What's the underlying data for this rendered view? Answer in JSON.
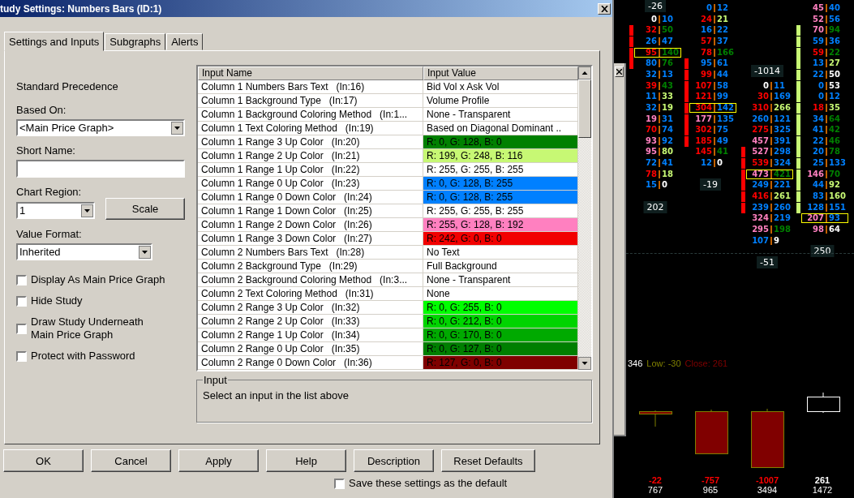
{
  "dialog": {
    "title": "tudy Settings: Numbers Bars (ID:1)",
    "tabs": [
      {
        "label": "Settings and Inputs",
        "selected": true
      },
      {
        "label": "Subgraphs",
        "selected": false
      },
      {
        "label": "Alerts",
        "selected": false
      }
    ],
    "precedence": "Standard Precedence",
    "based_on": {
      "label": "Based On:",
      "value": "<Main Price Graph>"
    },
    "short_name": {
      "label": "Short Name:"
    },
    "chart_region": {
      "label": "Chart Region:",
      "value": "1"
    },
    "scale_button": "Scale",
    "value_format": {
      "label": "Value Format:",
      "value": "Inherited"
    },
    "options": [
      {
        "label": "Display As Main Price Graph",
        "checked": false
      },
      {
        "label": "Hide Study",
        "checked": false
      },
      {
        "label": "Draw Study Underneath Main Price Graph",
        "checked": false
      },
      {
        "label": "Protect with Password",
        "checked": false
      }
    ],
    "table": {
      "columns": [
        "Input Name",
        "Input Value"
      ],
      "rows": [
        {
          "name": "Column 1 Numbers Bars Text   (In:16)",
          "value": "Bid Vol x Ask Vol"
        },
        {
          "name": "Column 1 Background Type   (In:17)",
          "value": "Volume Profile"
        },
        {
          "name": "Column 1 Background Coloring Method   (In:1...",
          "value": "None - Transparent"
        },
        {
          "name": "Column 1 Text Coloring Method   (In:19)",
          "value": "Based on Diagonal Dominant .."
        },
        {
          "name": "Column 1 Range 3 Up Color   (In:20)",
          "value": "R: 0, G: 128, B: 0",
          "color": "#008000"
        },
        {
          "name": "Column 1 Range 2 Up Color   (In:21)",
          "value": "R: 199, G: 248, B: 116",
          "color": "#c7f874"
        },
        {
          "name": "Column 1 Range 1 Up Color   (In:22)",
          "value": "R: 255, G: 255, B: 255",
          "color": "#ffffff"
        },
        {
          "name": "Column 1 Range 0 Up Color   (In:23)",
          "value": "R: 0, G: 128, B: 255",
          "color": "#0080ff"
        },
        {
          "name": "Column 1 Range 0 Down Color   (In:24)",
          "value": "R: 0, G: 128, B: 255",
          "color": "#0080ff"
        },
        {
          "name": "Column 1 Range 1 Down Color   (In:25)",
          "value": "R: 255, G: 255, B: 255",
          "color": "#ffffff"
        },
        {
          "name": "Column 1 Range 2 Down Color   (In:26)",
          "value": "R: 255, G: 128, B: 192",
          "color": "#ff80c0"
        },
        {
          "name": "Column 1 Range 3 Down Color   (In:27)",
          "value": "R: 242, G: 0, B: 0",
          "color": "#f20000"
        },
        {
          "name": "Column 2 Numbers Bars Text   (In:28)",
          "value": "No Text"
        },
        {
          "name": "Column 2 Background Type   (In:29)",
          "value": "Full Background"
        },
        {
          "name": "Column 2 Background Coloring Method   (In:3...",
          "value": "None - Transparent"
        },
        {
          "name": "Column 2 Text Coloring Method   (In:31)",
          "value": "None"
        },
        {
          "name": "Column 2 Range 3 Up Color   (In:32)",
          "value": "R: 0, G: 255, B: 0",
          "color": "#00ff00"
        },
        {
          "name": "Column 2 Range 2 Up Color   (In:33)",
          "value": "R: 0, G: 212, B: 0",
          "color": "#00d400"
        },
        {
          "name": "Column 2 Range 1 Up Color   (In:34)",
          "value": "R: 0, G: 170, B: 0",
          "color": "#00aa00"
        },
        {
          "name": "Column 2 Range 0 Up Color   (In:35)",
          "value": "R: 0, G: 127, B: 0",
          "color": "#007f00"
        },
        {
          "name": "Column 2 Range 0 Down Color   (In:36)",
          "value": "R: 127, G: 0, B: 0",
          "color": "#7f0000"
        }
      ]
    },
    "input_group": {
      "title": "Input",
      "text": "Select an input in the list above"
    },
    "buttons": [
      "OK",
      "Cancel",
      "Apply",
      "Help",
      "Description",
      "Reset Defaults"
    ],
    "save_default": {
      "label": "Save these settings as the default",
      "checked": false
    }
  },
  "chart": {
    "columns": [
      {
        "top_label": "-26",
        "color": "#ff0000",
        "bottom_label": "202",
        "rows": [
          {
            "bid": {
              "text": "0",
              "color": "#ffffff"
            },
            "ask": {
              "text": "10",
              "color": "#0080ff"
            },
            "bar": false,
            "boxed": false
          },
          {
            "bid": {
              "text": "32",
              "color": "#ff0000"
            },
            "ask": {
              "text": "50",
              "color": "#008000"
            },
            "bar": true,
            "boxed": false
          },
          {
            "bid": {
              "text": "26",
              "color": "#0080ff"
            },
            "ask": {
              "text": "47",
              "color": "#0080ff"
            },
            "bar": true,
            "boxed": false
          },
          {
            "bid": {
              "text": "95",
              "color": "#ff0000"
            },
            "ask": {
              "text": "140",
              "color": "#008000"
            },
            "bar": true,
            "boxed": true
          },
          {
            "bid": {
              "text": "80",
              "color": "#0080ff"
            },
            "ask": {
              "text": "76",
              "color": "#008000"
            },
            "bar": true,
            "boxed": false
          },
          {
            "bid": {
              "text": "32",
              "color": "#0080ff"
            },
            "ask": {
              "text": "13",
              "color": "#0080ff"
            },
            "bar": false,
            "boxed": false
          },
          {
            "bid": {
              "text": "39",
              "color": "#ff0000"
            },
            "ask": {
              "text": "43",
              "color": "#008000"
            },
            "bar": false,
            "boxed": false
          },
          {
            "bid": {
              "text": "11",
              "color": "#0080ff"
            },
            "ask": {
              "text": "33",
              "color": "#c7f874"
            },
            "bar": false,
            "boxed": false
          },
          {
            "bid": {
              "text": "32",
              "color": "#0080ff"
            },
            "ask": {
              "text": "19",
              "color": "#c7f874"
            },
            "bar": false,
            "boxed": false
          },
          {
            "bid": {
              "text": "19",
              "color": "#ff80c0"
            },
            "ask": {
              "text": "31",
              "color": "#0080ff"
            },
            "bar": false,
            "boxed": false
          },
          {
            "bid": {
              "text": "70",
              "color": "#ff0000"
            },
            "ask": {
              "text": "74",
              "color": "#0080ff"
            },
            "bar": false,
            "boxed": false
          },
          {
            "bid": {
              "text": "93",
              "color": "#ff80c0"
            },
            "ask": {
              "text": "92",
              "color": "#0080ff"
            },
            "bar": false,
            "boxed": false
          },
          {
            "bid": {
              "text": "95",
              "color": "#ff80c0"
            },
            "ask": {
              "text": "80",
              "color": "#c7f874"
            },
            "bar": false,
            "boxed": false
          },
          {
            "bid": {
              "text": "72",
              "color": "#0080ff"
            },
            "ask": {
              "text": "41",
              "color": "#0080ff"
            },
            "bar": false,
            "boxed": false
          },
          {
            "bid": {
              "text": "78",
              "color": "#ff0000"
            },
            "ask": {
              "text": "18",
              "color": "#c7f874"
            },
            "bar": false,
            "boxed": false
          },
          {
            "bid": {
              "text": "15",
              "color": "#0080ff"
            },
            "ask": {
              "text": "0",
              "color": "#ffffff"
            },
            "bar": false,
            "boxed": false
          }
        ]
      },
      {
        "color": "#ff0000",
        "bottom_label": "-19",
        "rows": [
          {
            "bid": {
              "text": "0",
              "color": "#0080ff"
            },
            "ask": {
              "text": "12",
              "color": "#0080ff"
            },
            "bar": false,
            "boxed": false
          },
          {
            "bid": {
              "text": "24",
              "color": "#ff0000"
            },
            "ask": {
              "text": "21",
              "color": "#c7f874"
            },
            "bar": false,
            "boxed": false
          },
          {
            "bid": {
              "text": "16",
              "color": "#0080ff"
            },
            "ask": {
              "text": "22",
              "color": "#0080ff"
            },
            "bar": false,
            "boxed": false
          },
          {
            "bid": {
              "text": "57",
              "color": "#ff0000"
            },
            "ask": {
              "text": "37",
              "color": "#0080ff"
            },
            "bar": false,
            "boxed": false
          },
          {
            "bid": {
              "text": "78",
              "color": "#ff0000"
            },
            "ask": {
              "text": "166",
              "color": "#008000"
            },
            "bar": false,
            "boxed": false
          },
          {
            "bid": {
              "text": "95",
              "color": "#0080ff"
            },
            "ask": {
              "text": "61",
              "color": "#0080ff"
            },
            "bar": true,
            "boxed": false
          },
          {
            "bid": {
              "text": "99",
              "color": "#ff0000"
            },
            "ask": {
              "text": "44",
              "color": "#0080ff"
            },
            "bar": true,
            "boxed": false
          },
          {
            "bid": {
              "text": "107",
              "color": "#ff0000"
            },
            "ask": {
              "text": "58",
              "color": "#0080ff"
            },
            "bar": true,
            "boxed": false
          },
          {
            "bid": {
              "text": "121",
              "color": "#ff0000"
            },
            "ask": {
              "text": "99",
              "color": "#0080ff"
            },
            "bar": true,
            "boxed": false
          },
          {
            "bid": {
              "text": "304",
              "color": "#ff0000"
            },
            "ask": {
              "text": "142",
              "color": "#0080ff"
            },
            "bar": true,
            "boxed": true
          },
          {
            "bid": {
              "text": "177",
              "color": "#ff80c0"
            },
            "ask": {
              "text": "135",
              "color": "#0080ff"
            },
            "bar": true,
            "boxed": false
          },
          {
            "bid": {
              "text": "302",
              "color": "#ff0000"
            },
            "ask": {
              "text": "75",
              "color": "#0080ff"
            },
            "bar": true,
            "boxed": false
          },
          {
            "bid": {
              "text": "185",
              "color": "#ff0000"
            },
            "ask": {
              "text": "49",
              "color": "#0080ff"
            },
            "bar": true,
            "boxed": false
          },
          {
            "bid": {
              "text": "145",
              "color": "#ff0000"
            },
            "ask": {
              "text": "41",
              "color": "#008000"
            },
            "bar": false,
            "boxed": false
          },
          {
            "bid": {
              "text": "12",
              "color": "#0080ff"
            },
            "ask": {
              "text": "0",
              "color": "#ffffff"
            },
            "bar": false,
            "boxed": false
          }
        ]
      },
      {
        "top_label": "-1014",
        "color": "#ff0000",
        "bottom_label": "-51",
        "rows": [
          {
            "bid": {
              "text": "0",
              "color": "#ffffff"
            },
            "ask": {
              "text": "11",
              "color": "#0080ff"
            },
            "bar": false,
            "boxed": false
          },
          {
            "bid": {
              "text": "30",
              "color": "#ff0000"
            },
            "ask": {
              "text": "169",
              "color": "#0080ff"
            },
            "bar": false,
            "boxed": false
          },
          {
            "bid": {
              "text": "310",
              "color": "#ff0000"
            },
            "ask": {
              "text": "266",
              "color": "#c7f874"
            },
            "bar": false,
            "boxed": false
          },
          {
            "bid": {
              "text": "260",
              "color": "#0080ff"
            },
            "ask": {
              "text": "121",
              "color": "#0080ff"
            },
            "bar": false,
            "boxed": false
          },
          {
            "bid": {
              "text": "275",
              "color": "#ff0000"
            },
            "ask": {
              "text": "325",
              "color": "#0080ff"
            },
            "bar": false,
            "boxed": false
          },
          {
            "bid": {
              "text": "457",
              "color": "#ff80c0"
            },
            "ask": {
              "text": "391",
              "color": "#0080ff"
            },
            "bar": false,
            "boxed": false
          },
          {
            "bid": {
              "text": "527",
              "color": "#ff80c0"
            },
            "ask": {
              "text": "298",
              "color": "#0080ff"
            },
            "bar": true,
            "boxed": false
          },
          {
            "bid": {
              "text": "539",
              "color": "#ff0000"
            },
            "ask": {
              "text": "324",
              "color": "#0080ff"
            },
            "bar": true,
            "boxed": false
          },
          {
            "bid": {
              "text": "473",
              "color": "#ff80c0"
            },
            "ask": {
              "text": "421",
              "color": "#008000"
            },
            "bar": true,
            "boxed": true
          },
          {
            "bid": {
              "text": "249",
              "color": "#0080ff"
            },
            "ask": {
              "text": "221",
              "color": "#0080ff"
            },
            "bar": true,
            "boxed": false
          },
          {
            "bid": {
              "text": "416",
              "color": "#ff0000"
            },
            "ask": {
              "text": "261",
              "color": "#c7f874"
            },
            "bar": true,
            "boxed": false
          },
          {
            "bid": {
              "text": "239",
              "color": "#0080ff"
            },
            "ask": {
              "text": "260",
              "color": "#0080ff"
            },
            "bar": true,
            "boxed": false
          },
          {
            "bid": {
              "text": "324",
              "color": "#ff80c0"
            },
            "ask": {
              "text": "219",
              "color": "#0080ff"
            },
            "bar": false,
            "boxed": false
          },
          {
            "bid": {
              "text": "295",
              "color": "#ff80c0"
            },
            "ask": {
              "text": "198",
              "color": "#008000"
            },
            "bar": false,
            "boxed": false
          },
          {
            "bid": {
              "text": "107",
              "color": "#0080ff"
            },
            "ask": {
              "text": "9",
              "color": "#ffffff"
            },
            "bar": false,
            "boxed": false
          }
        ]
      },
      {
        "color": "#c7f874",
        "bottom_label": "250",
        "rows": [
          {
            "bid": {
              "text": "45",
              "color": "#ff80c0"
            },
            "ask": {
              "text": "40",
              "color": "#0080ff"
            },
            "bar": false,
            "boxed": false
          },
          {
            "bid": {
              "text": "52",
              "color": "#ff80c0"
            },
            "ask": {
              "text": "56",
              "color": "#0080ff"
            },
            "bar": false,
            "boxed": false
          },
          {
            "bid": {
              "text": "70",
              "color": "#ff80c0"
            },
            "ask": {
              "text": "94",
              "color": "#008000"
            },
            "bar": true,
            "boxed": false
          },
          {
            "bid": {
              "text": "59",
              "color": "#0080ff"
            },
            "ask": {
              "text": "36",
              "color": "#0080ff"
            },
            "bar": true,
            "boxed": false
          },
          {
            "bid": {
              "text": "59",
              "color": "#ff0000"
            },
            "ask": {
              "text": "22",
              "color": "#008000"
            },
            "bar": true,
            "boxed": false
          },
          {
            "bid": {
              "text": "13",
              "color": "#0080ff"
            },
            "ask": {
              "text": "27",
              "color": "#c7f874"
            },
            "bar": true,
            "boxed": false
          },
          {
            "bid": {
              "text": "22",
              "color": "#0080ff"
            },
            "ask": {
              "text": "50",
              "color": "#ffffff"
            },
            "bar": true,
            "boxed": false
          },
          {
            "bid": {
              "text": "0",
              "color": "#0080ff"
            },
            "ask": {
              "text": "53",
              "color": "#ffffff"
            },
            "bar": true,
            "boxed": false
          },
          {
            "bid": {
              "text": "0",
              "color": "#0080ff"
            },
            "ask": {
              "text": "12",
              "color": "#0080ff"
            },
            "bar": true,
            "boxed": false
          },
          {
            "bid": {
              "text": "18",
              "color": "#ff0000"
            },
            "ask": {
              "text": "35",
              "color": "#c7f874"
            },
            "bar": true,
            "boxed": false
          },
          {
            "bid": {
              "text": "34",
              "color": "#0080ff"
            },
            "ask": {
              "text": "64",
              "color": "#008000"
            },
            "bar": true,
            "boxed": false
          },
          {
            "bid": {
              "text": "41",
              "color": "#0080ff"
            },
            "ask": {
              "text": "42",
              "color": "#008000"
            },
            "bar": true,
            "boxed": false
          },
          {
            "bid": {
              "text": "22",
              "color": "#0080ff"
            },
            "ask": {
              "text": "46",
              "color": "#008000"
            },
            "bar": true,
            "boxed": false
          },
          {
            "bid": {
              "text": "20",
              "color": "#0080ff"
            },
            "ask": {
              "text": "78",
              "color": "#008000"
            },
            "bar": true,
            "boxed": false
          },
          {
            "bid": {
              "text": "25",
              "color": "#0080ff"
            },
            "ask": {
              "text": "133",
              "color": "#0080ff"
            },
            "bar": true,
            "boxed": false
          },
          {
            "bid": {
              "text": "146",
              "color": "#ff80c0"
            },
            "ask": {
              "text": "70",
              "color": "#008000"
            },
            "bar": true,
            "boxed": false
          },
          {
            "bid": {
              "text": "44",
              "color": "#0080ff"
            },
            "ask": {
              "text": "92",
              "color": "#c7f874"
            },
            "bar": true,
            "boxed": false
          },
          {
            "bid": {
              "text": "83",
              "color": "#0080ff"
            },
            "ask": {
              "text": "160",
              "color": "#c7f874"
            },
            "bar": true,
            "boxed": false
          },
          {
            "bid": {
              "text": "128",
              "color": "#0080ff"
            },
            "ask": {
              "text": "151",
              "color": "#0080ff"
            },
            "bar": true,
            "boxed": false
          },
          {
            "bid": {
              "text": "207",
              "color": "#ff80c0"
            },
            "ask": {
              "text": "93",
              "color": "#0080ff"
            },
            "bar": false,
            "boxed": true
          },
          {
            "bid": {
              "text": "98",
              "color": "#ff80c0"
            },
            "ask": {
              "text": "64",
              "color": "#ffffff"
            },
            "bar": false,
            "boxed": false
          }
        ]
      }
    ],
    "ohlc_labels": [
      {
        "text": "346",
        "color": "#ffffff"
      },
      {
        "text": "Low: -30",
        "color": "#808000"
      },
      {
        "text": "Close: 261",
        "color": "#800000"
      }
    ],
    "bar_stats": [
      {
        "delta": {
          "text": "-22",
          "color": "#ff0000"
        },
        "volume": "767"
      },
      {
        "delta": {
          "text": "-757",
          "color": "#ff0000"
        },
        "volume": "965"
      },
      {
        "delta": {
          "text": "-1007",
          "color": "#ff0000"
        },
        "volume": "3494"
      },
      {
        "delta": {
          "text": "261",
          "color": "#ffffff"
        },
        "volume": "1472"
      }
    ]
  }
}
